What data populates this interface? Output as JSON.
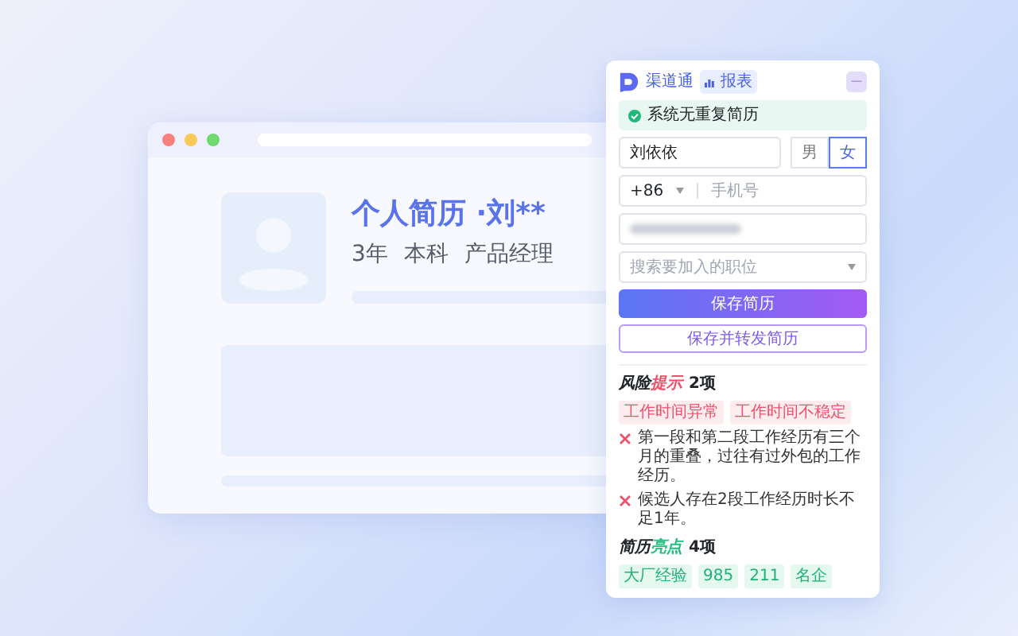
{
  "mockup": {
    "title": "个人简历 ·刘**",
    "subtitle": [
      "3年",
      "本科",
      "产品经理"
    ]
  },
  "panel": {
    "logo_text": "渠道通",
    "badge": "报表",
    "minimize": "—"
  },
  "status": {
    "text": "系统无重复简历",
    "ok": true
  },
  "form": {
    "name_value": "刘依依",
    "genders": [
      {
        "label": "男",
        "selected": false
      },
      {
        "label": "女",
        "selected": true
      }
    ],
    "country_code": "+86",
    "phone_placeholder": "手机号",
    "position_placeholder": "搜索要加入的职位"
  },
  "buttons": [
    {
      "label": "保存简历",
      "kind": "primary"
    },
    {
      "label": "保存并转发简历",
      "kind": "outline"
    }
  ],
  "sections": [
    {
      "kind": "risk",
      "title_lead": "风险",
      "title_accent": "提示",
      "count": "2项",
      "tags": [
        "工作时间异常",
        "工作时间不稳定"
      ],
      "issues": [
        "第一段和第二段工作经历有三个月的重叠，过往有过外包的工作经历。",
        "候选人存在2段工作经历时长不足1年。"
      ]
    },
    {
      "kind": "highlight",
      "title_lead": "简历",
      "title_accent": "亮点",
      "count": "4项",
      "tags": [
        "大厂经验",
        "985",
        "211",
        "名企"
      ]
    }
  ]
}
